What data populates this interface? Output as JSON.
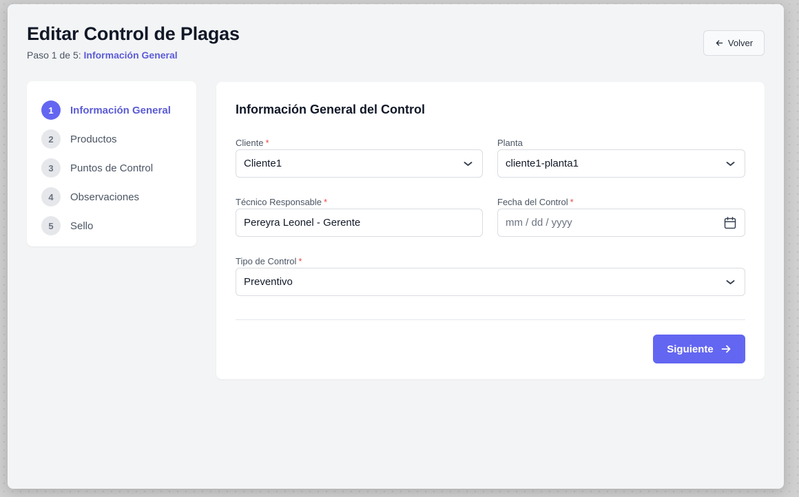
{
  "header": {
    "title": "Editar Control de Plagas",
    "step_prefix": "Paso 1 de 5:",
    "step_name": "Información General",
    "back_label": "Volver"
  },
  "steps": [
    {
      "number": "1",
      "label": "Información General",
      "active": true
    },
    {
      "number": "2",
      "label": "Productos",
      "active": false
    },
    {
      "number": "3",
      "label": "Puntos de Control",
      "active": false
    },
    {
      "number": "4",
      "label": "Observaciones",
      "active": false
    },
    {
      "number": "5",
      "label": "Sello",
      "active": false
    }
  ],
  "form": {
    "title": "Información General del Control",
    "required_mark": "*",
    "cliente": {
      "label": "Cliente",
      "value": "Cliente1"
    },
    "planta": {
      "label": "Planta",
      "value": "cliente1-planta1"
    },
    "tecnico": {
      "label": "Técnico Responsable",
      "value": "Pereyra Leonel - Gerente"
    },
    "fecha": {
      "label": "Fecha del Control",
      "placeholder": "mm / dd / yyyy",
      "value": ""
    },
    "tipo": {
      "label": "Tipo de Control",
      "value": "Preventivo"
    },
    "next_label": "Siguiente"
  },
  "colors": {
    "accent": "#6366f1",
    "required": "#ef4444",
    "background": "#f3f4f6"
  },
  "icons": {
    "back": "arrow-left-icon",
    "next": "arrow-right-icon",
    "select": "chevron-down-icon",
    "date": "calendar-icon"
  }
}
